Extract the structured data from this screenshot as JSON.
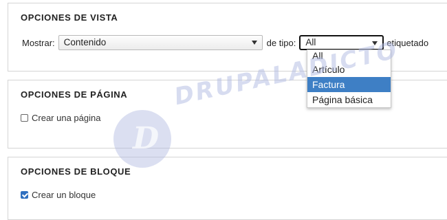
{
  "view_options": {
    "title": "OPCIONES DE VISTA",
    "show_label": "Mostrar:",
    "show_value": "Contenido",
    "type_label": "de tipo:",
    "type_value": "All",
    "tagged_label": "etiquetado",
    "type_options": [
      "All",
      "Artículo",
      "Factura",
      "Página básica"
    ],
    "highlighted_option": "Factura"
  },
  "page_options": {
    "title": "OPCIONES DE PÁGINA",
    "checkbox_label": "Crear una página",
    "checked": false
  },
  "block_options": {
    "title": "OPCIONES DE BLOQUE",
    "checkbox_label": "Crear un bloque",
    "checked": true
  },
  "watermark": {
    "text": "DRUPALADICTO",
    "logo_letter": "D"
  },
  "colors": {
    "highlight": "#3e7fc5",
    "checkbox_checked": "#2f6fbf"
  }
}
